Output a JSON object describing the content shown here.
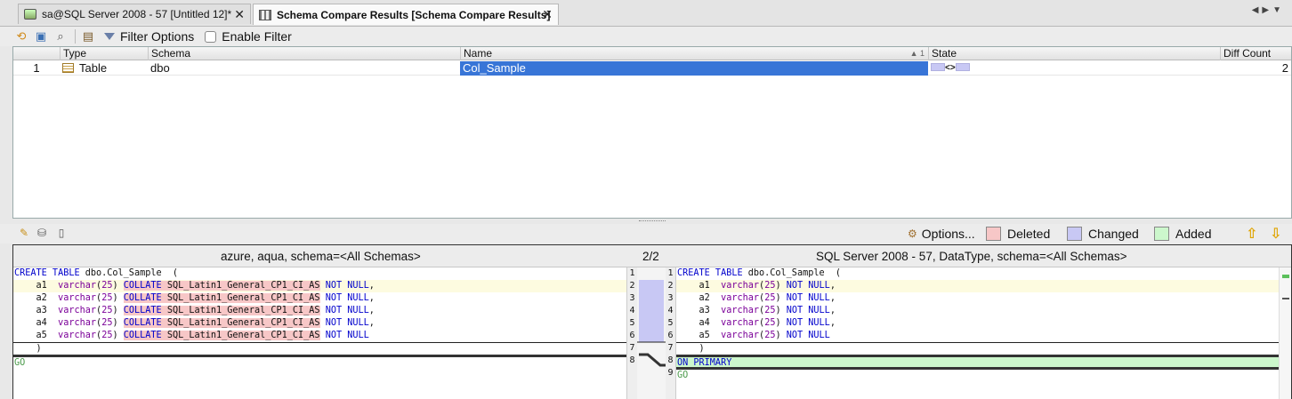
{
  "tabs": [
    {
      "label": "sa@SQL Server 2008 - 57 [Untitled 12]*",
      "active": false
    },
    {
      "label": "Schema Compare Results [Schema Compare Results]",
      "active": true
    }
  ],
  "toolbar": {
    "filter_options_label": "Filter Options",
    "enable_filter_label": "Enable Filter",
    "enable_filter_checked": false
  },
  "grid": {
    "columns": [
      "Type",
      "Schema",
      "Name",
      "State",
      "Diff Count"
    ],
    "sort_indicator": "1",
    "rows": [
      {
        "index": "1",
        "type": "Table",
        "schema": "dbo",
        "name": "Col_Sample",
        "state": "<>",
        "diff_count": "2"
      }
    ]
  },
  "diff_toolbar": {
    "options_label": "Options...",
    "legend": [
      {
        "label": "Deleted",
        "color": "#f7c7c7"
      },
      {
        "label": "Changed",
        "color": "#c8c8f4"
      },
      {
        "label": "Added",
        "color": "#ccf7cc"
      }
    ]
  },
  "diff": {
    "left_title": "azure, aqua,  schema=<All Schemas>",
    "position": "2/2",
    "right_title": "SQL Server 2008 - 57, DataType,  schema=<All Schemas>",
    "left_line_numbers": [
      "1",
      "2",
      "3",
      "4",
      "5",
      "6",
      "7",
      "8"
    ],
    "right_line_numbers": [
      "1",
      "2",
      "3",
      "4",
      "5",
      "6",
      "7",
      "8",
      "9"
    ],
    "left_lines": {
      "l1a": "CREATE TABLE",
      "l1b": " dbo.Col_Sample  (",
      "cols": [
        {
          "name": "a1",
          "type": "varchar",
          "len": "25",
          "collate": "COLLATE",
          "collation": "SQL_Latin1_General_CP1_CI_AS",
          "notnull": "NOT NULL",
          "end": ","
        },
        {
          "name": "a2",
          "type": "varchar",
          "len": "25",
          "collate": "COLLATE",
          "collation": "SQL_Latin1_General_CP1_CI_AS",
          "notnull": "NOT NULL",
          "end": ","
        },
        {
          "name": "a3",
          "type": "varchar",
          "len": "25",
          "collate": "COLLATE",
          "collation": "SQL_Latin1_General_CP1_CI_AS",
          "notnull": "NOT NULL",
          "end": ","
        },
        {
          "name": "a4",
          "type": "varchar",
          "len": "25",
          "collate": "COLLATE",
          "collation": "SQL_Latin1_General_CP1_CI_AS",
          "notnull": "NOT NULL",
          "end": ","
        },
        {
          "name": "a5",
          "type": "varchar",
          "len": "25",
          "collate": "COLLATE",
          "collation": "SQL_Latin1_General_CP1_CI_AS",
          "notnull": "NOT NULL",
          "end": ""
        }
      ],
      "close": "    )",
      "go": "GO"
    },
    "right_lines": {
      "l1a": "CREATE TABLE",
      "l1b": " dbo.Col_Sample  (",
      "cols": [
        {
          "name": "a1",
          "type": "varchar",
          "len": "25",
          "notnull": "NOT NULL",
          "end": ","
        },
        {
          "name": "a2",
          "type": "varchar",
          "len": "25",
          "notnull": "NOT NULL",
          "end": ","
        },
        {
          "name": "a3",
          "type": "varchar",
          "len": "25",
          "notnull": "NOT NULL",
          "end": ","
        },
        {
          "name": "a4",
          "type": "varchar",
          "len": "25",
          "notnull": "NOT NULL",
          "end": ","
        },
        {
          "name": "a5",
          "type": "varchar",
          "len": "25",
          "notnull": "NOT NULL",
          "end": ""
        }
      ],
      "close": "    )",
      "on_primary": "ON PRIMARY",
      "go": "GO"
    }
  }
}
